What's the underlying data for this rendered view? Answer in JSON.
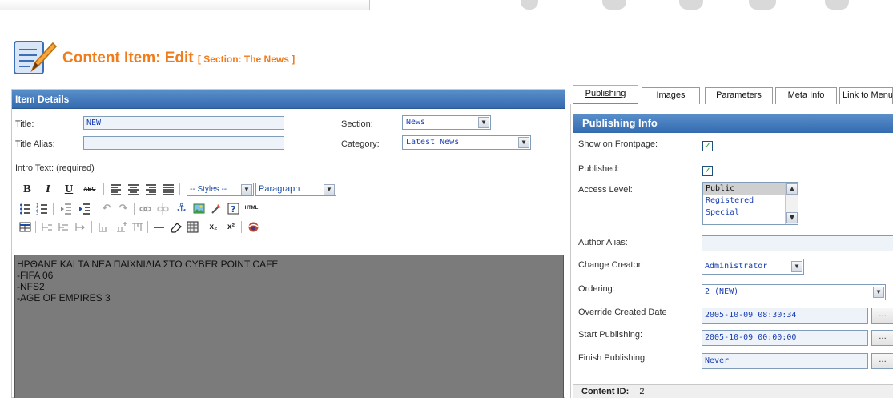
{
  "header": {
    "title": "Content Item: Edit",
    "section_label": "[ Section: The News ]"
  },
  "item_details": {
    "panel_title": "Item Details",
    "title_label": "Title:",
    "title_value": "NEW",
    "alias_label": "Title Alias:",
    "alias_value": "",
    "section_label": "Section:",
    "section_value": "News",
    "category_label": "Category:",
    "category_value": "Latest News",
    "intro_label": "Intro Text: (required)"
  },
  "toolbar": {
    "bold": "B",
    "italic": "I",
    "underline": "U",
    "strike": "ABC",
    "styles_select": "-- Styles --",
    "format_select": "Paragraph",
    "html_label": "HTML",
    "sub_label": "x₂",
    "sup_label": "x²"
  },
  "editor": {
    "lines": [
      "ΗΡΘΑΝΕ ΚΑΙ ΤΑ ΝΕΑ ΠΑΙΧΝΙΔΙΑ ΣΤΟ CYBER POINT CAFE",
      "-FIFA 06",
      "-NFS2",
      "-AGE OF EMPIRES 3"
    ]
  },
  "tabs": [
    {
      "label": "Publishing"
    },
    {
      "label": "Images"
    },
    {
      "label": "Parameters"
    },
    {
      "label": "Meta Info"
    },
    {
      "label": "Link to Menu"
    }
  ],
  "publishing": {
    "header": "Publishing Info",
    "frontpage_label": "Show on Frontpage:",
    "published_label": "Published:",
    "access_label": "Access Level:",
    "access_options": [
      "Public",
      "Registered",
      "Special"
    ],
    "access_selected": "Public",
    "author_alias_label": "Author Alias:",
    "author_alias_value": "",
    "creator_label": "Change Creator:",
    "creator_value": "Administrator",
    "ordering_label": "Ordering:",
    "ordering_value": "2 (NEW)",
    "override_label": "Override Created Date",
    "override_value": "2005-10-09 08:30:34",
    "start_label": "Start Publishing:",
    "start_value": "2005-10-09 00:00:00",
    "finish_label": "Finish Publishing:",
    "finish_value": "Never",
    "dots": "...",
    "content_id_label": "Content ID:",
    "content_id_value": "2"
  },
  "colors": {
    "accent_orange": "#f07c1b",
    "header_blue": "#346bb0",
    "editor_gray": "#7b7b7b",
    "check_green": "#21a121"
  }
}
